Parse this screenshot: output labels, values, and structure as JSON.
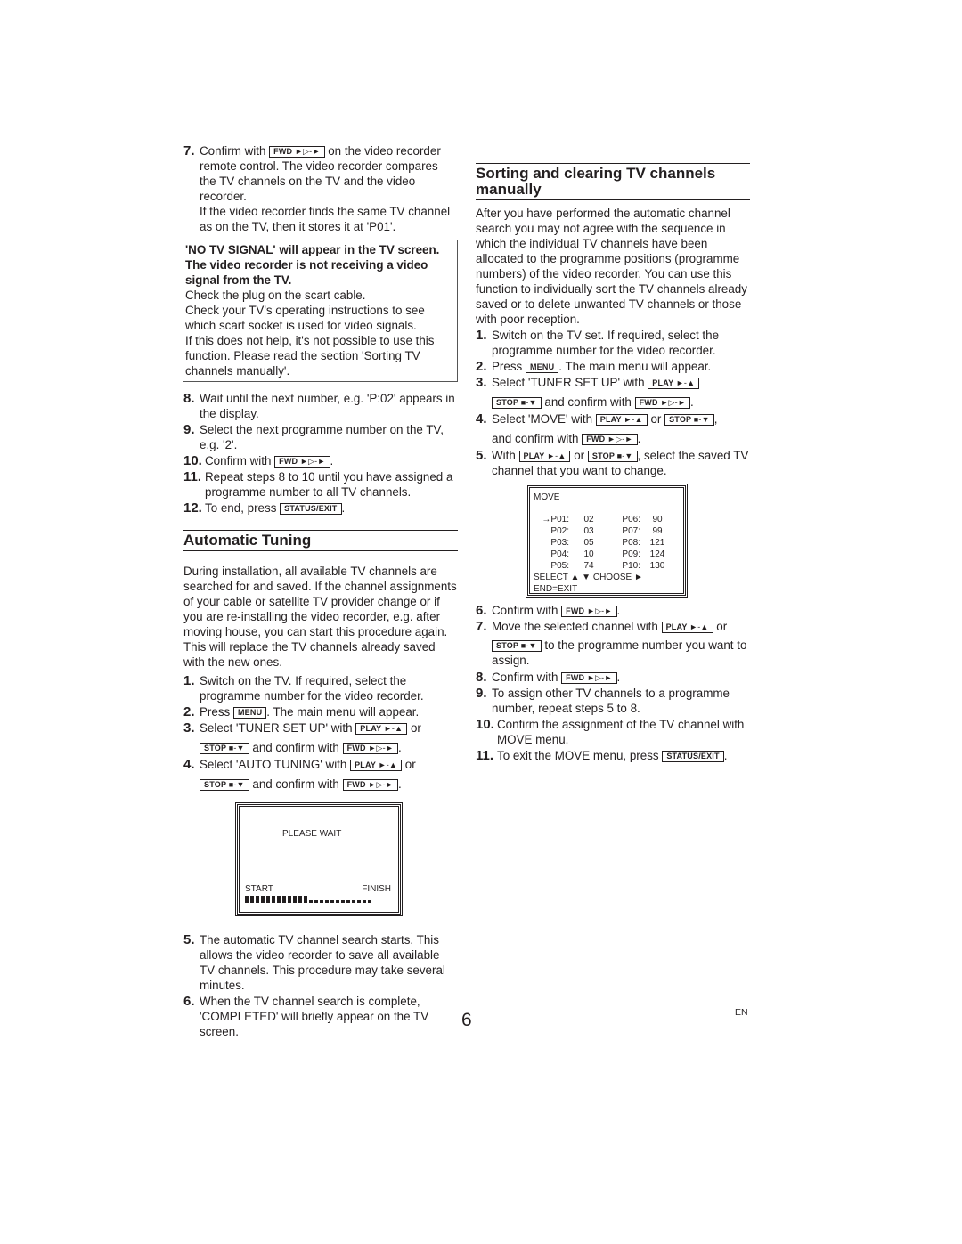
{
  "page": {
    "number": "6",
    "language": "EN"
  },
  "keys": {
    "fwd": {
      "label": "FWD",
      "glyph": "►▷-►"
    },
    "play": {
      "label": "PLAY",
      "glyph": "►-▲"
    },
    "stop": {
      "label": "STOP",
      "glyph": "■-▼"
    },
    "menu": {
      "label": "MENU"
    },
    "status_exit": {
      "label": "STATUS/EXIT"
    }
  },
  "left": {
    "step7": {
      "num": "7.",
      "pre": "Confirm with",
      "post": "on the video recorder remote control. The video recorder compares the TV channels on the TV and the video recorder.",
      "extra": "If the video recorder finds the same TV channel as on the TV, then it stores it at 'P01'."
    },
    "note": {
      "bold": "'NO TV SIGNAL' will appear in the TV screen. The video recorder is not receiving a video signal from the TV.",
      "lines": [
        "Check the plug on the scart cable.",
        "Check your TV's operating instructions to see which scart socket is used for video signals.",
        "If this does not help, it's not possible to use this function. Please read the section 'Sorting TV channels manually'."
      ]
    },
    "step8": {
      "num": "8.",
      "text": "Wait until the next number, e.g. 'P:02' appears in the display."
    },
    "step9": {
      "num": "9.",
      "text": "Select the next programme number on the TV, e.g. '2'."
    },
    "step10": {
      "num": "10.",
      "pre": "Confirm with",
      "post": "."
    },
    "step11": {
      "num": "11.",
      "text": "Repeat steps 8 to 10 until you have assigned a programme number to all TV channels."
    },
    "step12": {
      "num": "12.",
      "pre": "To end, press",
      "post": "."
    },
    "auto": {
      "heading": "Automatic Tuning",
      "intro": "During installation, all available TV channels are searched for and saved. If the channel assignments of your cable or satellite TV provider change or if you are re-installing the video recorder, e.g. after moving house, you can start this procedure again. This will replace the TV channels already saved with the new ones.",
      "step1": {
        "num": "1.",
        "text": "Switch on the TV. If required, select the programme number for the video recorder."
      },
      "step2": {
        "num": "2.",
        "pre": "Press",
        "post": ". The main menu will appear."
      },
      "step3": {
        "num": "3.",
        "pre": "Select 'TUNER SET UP' with",
        "mid": "or",
        "and": "and confirm with",
        "post": "."
      },
      "step4": {
        "num": "4.",
        "pre": "Select 'AUTO TUNING' with",
        "mid": "or",
        "and": "and confirm with",
        "post": "."
      },
      "screen": {
        "message": "PLEASE WAIT",
        "start": "START",
        "finish": "FINISH",
        "progress_percent": 50,
        "segments_total": 24
      },
      "step5": {
        "num": "5.",
        "text": "The automatic TV channel search starts. This allows the video recorder to save all available TV channels. This procedure may take several minutes."
      },
      "step6": {
        "num": "6.",
        "text": "When the TV channel search is complete, 'COMPLETED' will briefly appear on the TV screen."
      }
    }
  },
  "right": {
    "heading": "Sorting and clearing TV channels manually",
    "intro": "After you have performed the automatic channel search you may not agree with the sequence in which the individual TV channels have been allocated to the programme positions (programme numbers) of the video recorder. You can use this function to individually sort the TV channels already saved or to delete unwanted TV channels or those with poor reception.",
    "step1": {
      "num": "1.",
      "text": "Switch on the TV set. If required, select the programme number for the video recorder."
    },
    "step2": {
      "num": "2.",
      "pre": "Press",
      "post": ". The main menu will appear."
    },
    "step3": {
      "num": "3.",
      "pre": "Select 'TUNER SET UP' with",
      "and": "and confirm with",
      "post": "."
    },
    "step4": {
      "num": "4.",
      "pre": "Select 'MOVE' with",
      "mid": "or",
      "post1": ",",
      "and": "and confirm with",
      "post": "."
    },
    "step5": {
      "num": "5.",
      "pre": "With",
      "mid": "or",
      "post": ", select the saved TV channel that you want to change."
    },
    "screen": {
      "title": "MOVE",
      "cursor": "→",
      "rows": [
        {
          "p1": "P01:",
          "v1": "02",
          "p2": "P06:",
          "v2": "90"
        },
        {
          "p1": "P02:",
          "v1": "03",
          "p2": "P07:",
          "v2": "99"
        },
        {
          "p1": "P03:",
          "v1": "05",
          "p2": "P08:",
          "v2": "121"
        },
        {
          "p1": "P04:",
          "v1": "10",
          "p2": "P09:",
          "v2": "124"
        },
        {
          "p1": "P05:",
          "v1": "74",
          "p2": "P10:",
          "v2": "130"
        }
      ],
      "select": "SELECT ▲ ▼  CHOOSE ►",
      "end": "END=EXIT"
    },
    "step6": {
      "num": "6.",
      "pre": "Confirm with",
      "post": "."
    },
    "step7": {
      "num": "7.",
      "pre": "Move the selected channel with",
      "mid": "or",
      "post": "to the programme number you want to assign."
    },
    "step8": {
      "num": "8.",
      "pre": "Confirm with",
      "post": "."
    },
    "step9": {
      "num": "9.",
      "text": "To assign other TV channels to a programme number, repeat steps 5 to 8."
    },
    "step10": {
      "num": "10.",
      "text": "Confirm the assignment of the TV channel with MOVE menu."
    },
    "step11": {
      "num": "11.",
      "pre": "To exit the MOVE menu, press",
      "post": "."
    }
  }
}
